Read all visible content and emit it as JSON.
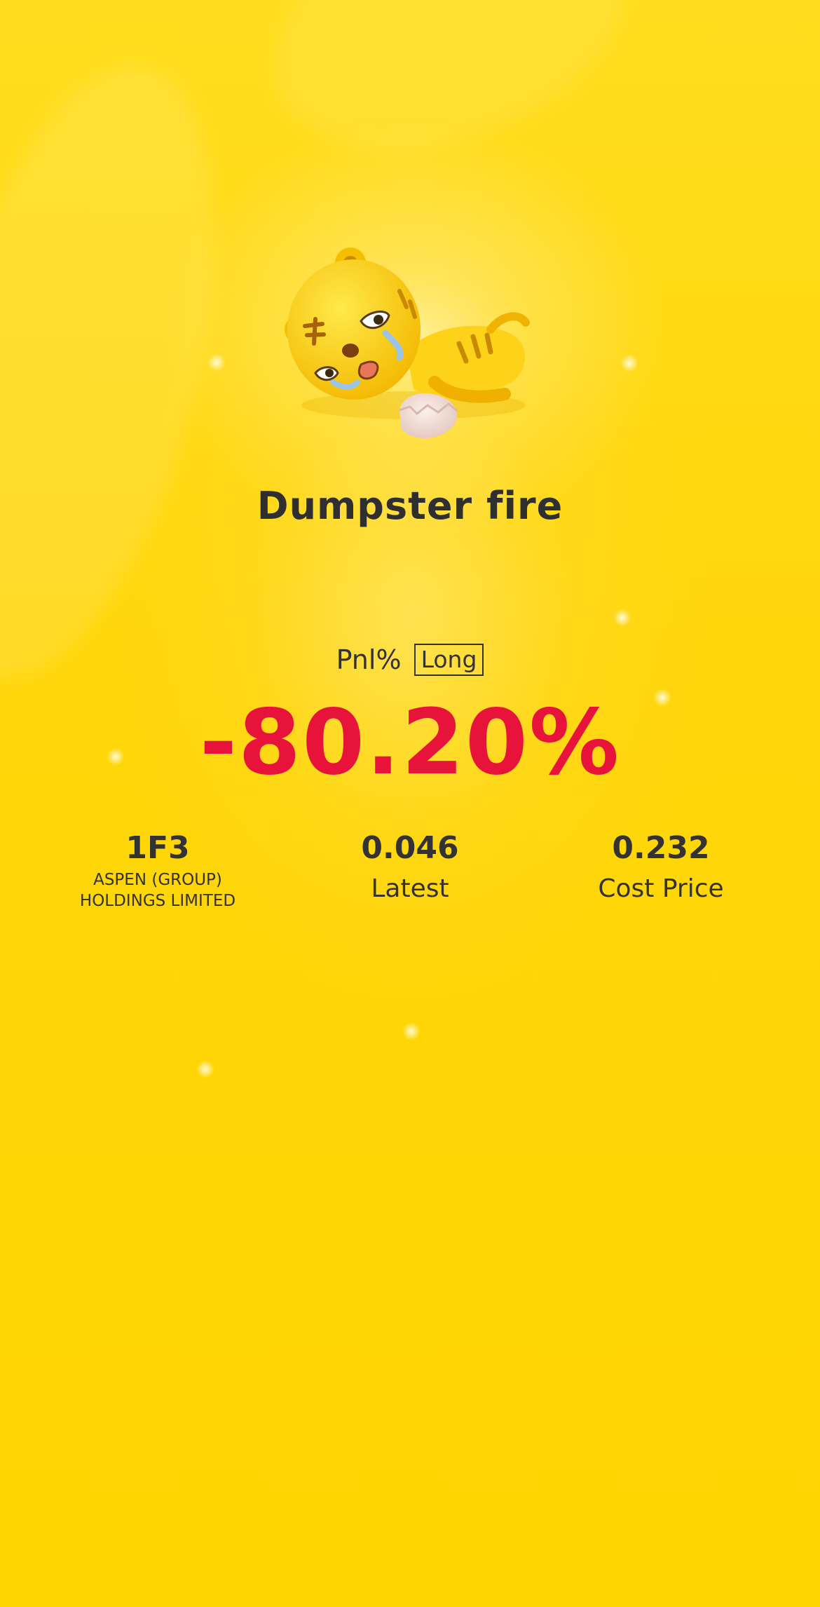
{
  "card": {
    "title": "Dumpster fire",
    "pnl_label": "Pnl%",
    "position_badge": "Long",
    "pnl_value": "-80.20%",
    "colors": {
      "background": "#FFD608",
      "loss": "#E8133A",
      "text": "#333333"
    },
    "illustration": "crying-tiger-mascot-with-broken-egg"
  },
  "stats": {
    "symbol": "1F3",
    "company_name_line1": "ASPEN (GROUP)",
    "company_name_line2": "HOLDINGS LIMITED",
    "latest_value": "0.046",
    "latest_label": "Latest",
    "cost_value": "0.232",
    "cost_label": "Cost Price"
  }
}
